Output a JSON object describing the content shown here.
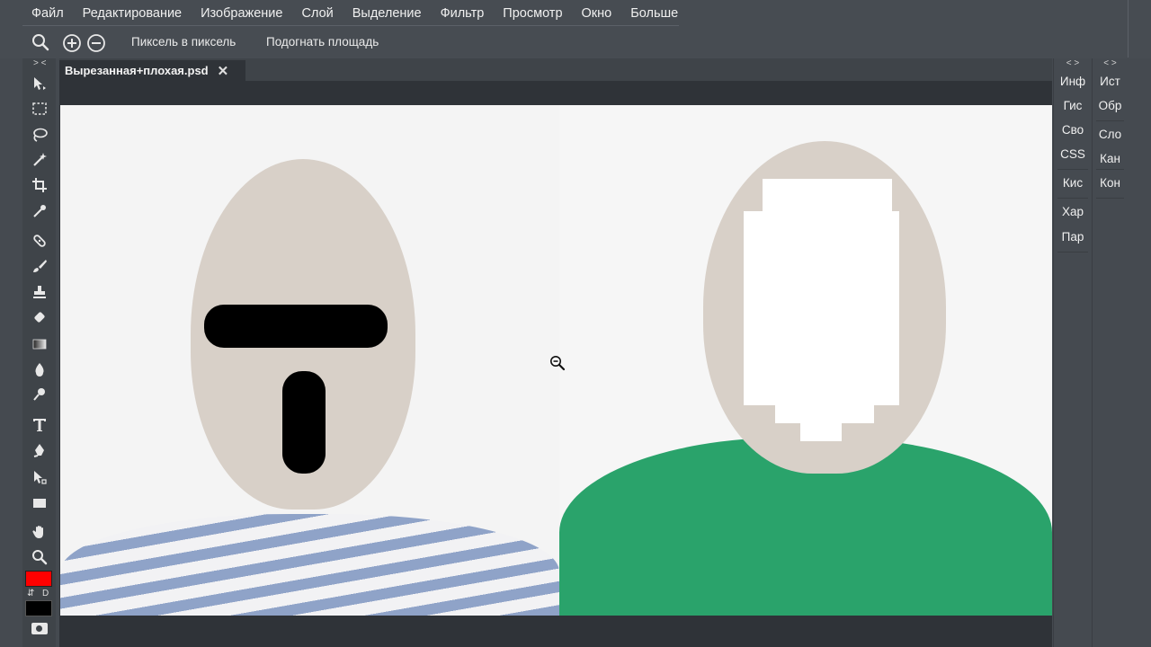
{
  "menu": [
    "Файл",
    "Редактирование",
    "Изображение",
    "Слой",
    "Выделение",
    "Фильтр",
    "Просмотр",
    "Окно",
    "Больше"
  ],
  "options": {
    "pixel_to_pixel": "Пиксель в пиксель",
    "fit_area": "Подогнать площадь"
  },
  "toolbar": {
    "collapse": ">  <",
    "tools": [
      "move-tool-icon",
      "rect-select-icon",
      "lasso-icon",
      "magic-wand-icon",
      "crop-icon",
      "eyedropper-icon",
      "healing-brush-icon",
      "brush-icon",
      "clone-stamp-icon",
      "eraser-icon",
      "gradient-icon",
      "blur-icon",
      "dodge-icon",
      "type-icon",
      "pen-icon",
      "path-select-icon",
      "rectangle-shape-icon",
      "hand-icon",
      "zoom-icon"
    ],
    "swap_label": "⇵",
    "default_label": "D",
    "foreground_color": "#ff0000",
    "background_color": "#000000"
  },
  "document": {
    "tab_title": "Вырезанная+плохая.psd",
    "close_label": "✕"
  },
  "panels": {
    "collapse_left": "< >",
    "collapse_right": "< >",
    "col1": [
      "Инф",
      "Гис",
      "Сво",
      "CSS",
      "Кис",
      "Хар",
      "Пар"
    ],
    "col2": [
      "Ист",
      "Обр",
      "Сло",
      "Кан",
      "Кон"
    ]
  },
  "colors": {
    "accent_red": "#ff0000",
    "shirt_green": "#2aa36b",
    "shirt_stripe": "#8fa3c8"
  }
}
